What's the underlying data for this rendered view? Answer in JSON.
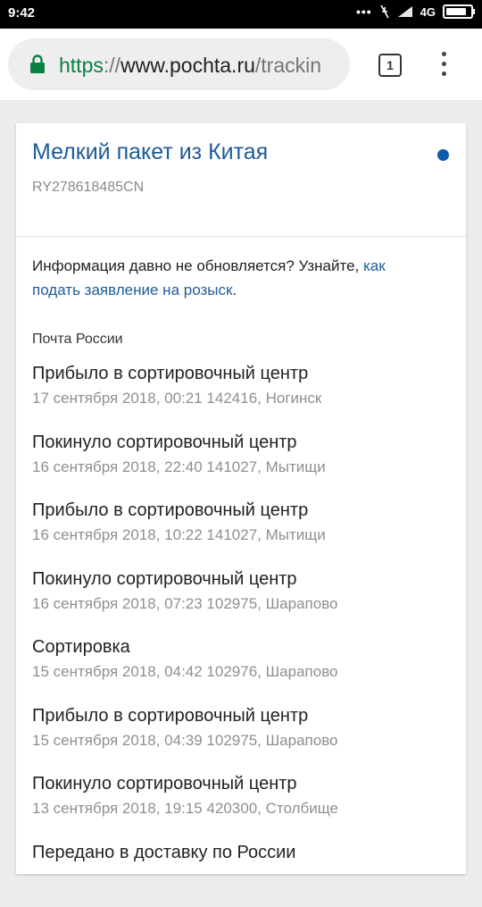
{
  "status_bar": {
    "time": "9:42",
    "network": "4G",
    "battery_level": 0.85
  },
  "browser": {
    "url": {
      "scheme": "https",
      "separator": "://",
      "host": "www.pochta.ru",
      "path": "/trackin"
    },
    "tab_count": "1",
    "secure_color": "#0b8043"
  },
  "parcel": {
    "title": "Мелкий пакет из Китая",
    "tracking_number": "RY278618485CN",
    "indicator_color": "#0d5ca8"
  },
  "notice": {
    "text": "Информация давно не обновляется? Узнайте, ",
    "link": "как подать заявление на розыск",
    "suffix": "."
  },
  "carrier": "Почта России",
  "events": [
    {
      "title": "Прибыло в сортировочный центр",
      "meta": "17 сентября 2018, 00:21 142416, Ногинск"
    },
    {
      "title": "Покинуло сортировочный центр",
      "meta": "16 сентября 2018, 22:40 141027, Мытищи"
    },
    {
      "title": "Прибыло в сортировочный центр",
      "meta": "16 сентября 2018, 10:22 141027, Мытищи"
    },
    {
      "title": "Покинуло сортировочный центр",
      "meta": "16 сентября 2018, 07:23 102975, Шарапово"
    },
    {
      "title": "Сортировка",
      "meta": "15 сентября 2018, 04:42 102976, Шарапово"
    },
    {
      "title": "Прибыло в сортировочный центр",
      "meta": "15 сентября 2018, 04:39 102975, Шарапово"
    },
    {
      "title": "Покинуло сортировочный центр",
      "meta": "13 сентября 2018, 19:15 420300, Столбище"
    },
    {
      "title": "Передано в доставку по России",
      "meta": ""
    }
  ]
}
